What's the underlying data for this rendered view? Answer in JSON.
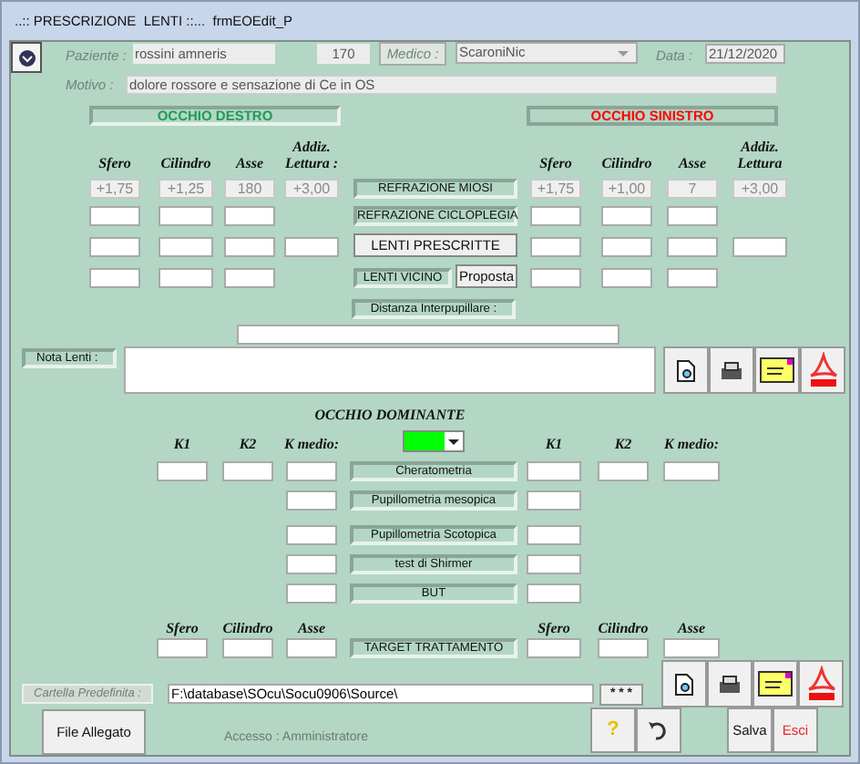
{
  "window": {
    "title": "..:: PRESCRIZIONE  LENTI ::...  frmEOEdit_P"
  },
  "header": {
    "patient_label": "Paziente :",
    "patient": "rossini amneris",
    "record": "170",
    "doctor_button": "Medico :",
    "doctor": "ScaroniNic",
    "date_label": "Data :",
    "date": "21/12/2020",
    "reason_label": "Motivo :",
    "reason": "dolore rossore e sensazione di  Ce in OS"
  },
  "eyes": {
    "right": {
      "title": "OCCHIO DESTRO",
      "color": "#1f9a55"
    },
    "left": {
      "title": "OCCHIO SINISTRO",
      "color": "#ff0000"
    }
  },
  "refraction": {
    "columns_right_eye": [
      "Sfero",
      "Cilindro",
      "Asse",
      "Addiz. Lettura :"
    ],
    "columns_left_eye": [
      "Sfero",
      "Cilindro",
      "Asse",
      "Addiz. Lettura"
    ],
    "rows": [
      {
        "label": "REFRAZIONE MIOSI",
        "kind": "label",
        "has_addition": true,
        "disabled": true,
        "right_eye": [
          "+1,75",
          "+1,25",
          "180",
          "+3,00"
        ],
        "left_eye": [
          "+1,75",
          "+1,00",
          "7",
          "+3,00"
        ]
      },
      {
        "label": "REFRAZIONE CICLOPLEGIA",
        "kind": "label",
        "has_addition": false,
        "disabled": false
      },
      {
        "label": "LENTI PRESCRITTE",
        "kind": "button",
        "has_addition": true,
        "disabled": false
      },
      {
        "label": "LENTI VICINO",
        "kind": "label",
        "extra_button": "Proposta",
        "has_addition": false,
        "disabled": false
      }
    ],
    "distance_label": "Distanza Interpupillare :"
  },
  "notes": {
    "label": "Nota Lenti :"
  },
  "dominant": {
    "title": "OCCHIO DOMINANTE",
    "columns_right_eye": [
      "K1",
      "K2",
      "K medio:"
    ],
    "columns_left_eye": [
      "K1",
      "K2",
      "K medio:"
    ],
    "color": "#00ff00",
    "rows": [
      {
        "label": "Cheratometria",
        "kind": "keratometry"
      },
      {
        "label": "Pupillometria mesopica",
        "kind": "single"
      },
      {
        "label": "Pupillometria Scotopica",
        "kind": "single"
      },
      {
        "label": "test di Shirmer",
        "kind": "single"
      },
      {
        "label": "BUT",
        "kind": "single"
      }
    ]
  },
  "target": {
    "label": "TARGET TRATTAMENTO",
    "columns_right_eye": [
      "Sfero",
      "Cilindro",
      "Asse"
    ],
    "columns_left_eye": [
      "Sfero",
      "Cilindro",
      "Asse"
    ]
  },
  "folder": {
    "label": "Cartella Predefinita :",
    "path": "F:\\database\\SOcu\\Socu0906\\Source\\",
    "browse_button": "* * *"
  },
  "footer": {
    "attach_button": "File Allegato",
    "access": "Accesso : Amministratore",
    "help_glyph": "?",
    "save_button": "Salva",
    "exit_button": "Esci"
  }
}
